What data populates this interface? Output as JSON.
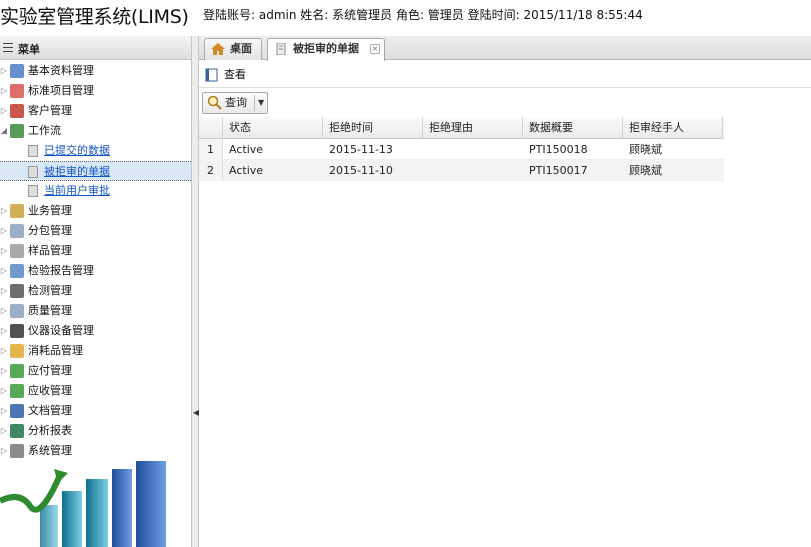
{
  "header": {
    "app_title": "实验室管理系统(LIMS)",
    "login_info": "登陆账号: admin 姓名: 系统管理员 角色: 管理员 登陆时间: 2015/11/18 8:55:44"
  },
  "sidebar": {
    "title": "菜单",
    "items": [
      {
        "label": "基本资料管理",
        "icon": "book-icon",
        "color": "#4a7dc4"
      },
      {
        "label": "标准项目管理",
        "icon": "standard-icon",
        "color": "#d9534f"
      },
      {
        "label": "客户管理",
        "icon": "user-icon",
        "color": "#c0392b"
      },
      {
        "label": "工作流",
        "icon": "workflow-icon",
        "color": "#3b8a3b",
        "children": [
          "已提交的数据",
          "被拒审的单据",
          "当前用户审批"
        ]
      },
      {
        "label": "业务管理",
        "icon": "clipboard-icon",
        "color": "#c9a23a"
      },
      {
        "label": "分包管理",
        "icon": "basket-icon",
        "color": "#8aa0b8"
      },
      {
        "label": "样品管理",
        "icon": "sample-icon",
        "color": "#9a9a9a"
      },
      {
        "label": "检验报告管理",
        "icon": "report-icon",
        "color": "#5b86c2"
      },
      {
        "label": "检测管理",
        "icon": "monitor-icon",
        "color": "#555"
      },
      {
        "label": "质量管理",
        "icon": "quality-icon",
        "color": "#8aa0b8"
      },
      {
        "label": "仪器设备管理",
        "icon": "camera-icon",
        "color": "#333"
      },
      {
        "label": "消耗品管理",
        "icon": "box-icon",
        "color": "#e0a92f"
      },
      {
        "label": "应付管理",
        "icon": "money-out-icon",
        "color": "#3a9a3a"
      },
      {
        "label": "应收管理",
        "icon": "money-in-icon",
        "color": "#3a9a3a"
      },
      {
        "label": "文档管理",
        "icon": "word-doc-icon",
        "color": "#2f5ea8"
      },
      {
        "label": "分析报表",
        "icon": "excel-icon",
        "color": "#217346"
      },
      {
        "label": "系统管理",
        "icon": "gear-icon",
        "color": "#777"
      }
    ],
    "selected_child": "被拒审的单据"
  },
  "tabs": [
    {
      "label": "桌面",
      "icon": "home-icon",
      "active": false
    },
    {
      "label": "被拒审的单据",
      "icon": "page-icon",
      "active": true
    }
  ],
  "toolbar": {
    "view_label": "查看",
    "query_label": "查询"
  },
  "grid": {
    "columns": [
      "状态",
      "拒绝时间",
      "拒绝理由",
      "数据概要",
      "拒审经手人"
    ],
    "rows": [
      {
        "num": "1",
        "status": "Active",
        "time": "2015-11-13",
        "reason": "",
        "summary": "PTI150018",
        "handler": "顾晓斌"
      },
      {
        "num": "2",
        "status": "Active",
        "time": "2015-11-10",
        "reason": "",
        "summary": "PTI150017",
        "handler": "顾晓斌"
      }
    ]
  }
}
